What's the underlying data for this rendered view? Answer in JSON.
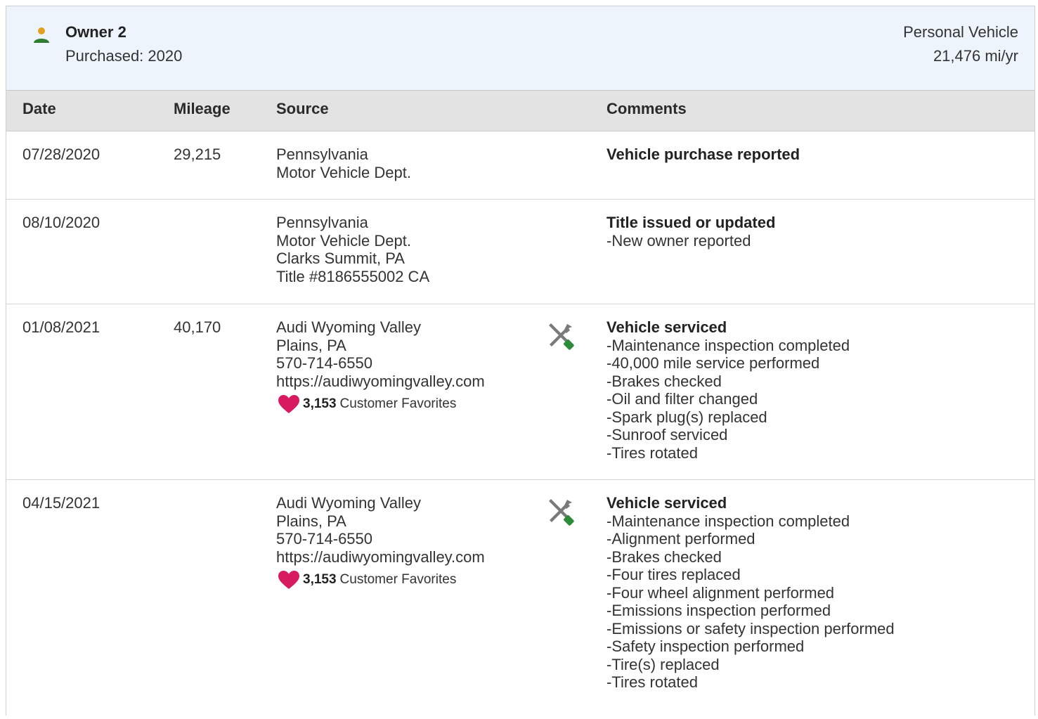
{
  "owner": {
    "title": "Owner 2",
    "purchased": "Purchased: 2020",
    "vehicle_type": "Personal Vehicle",
    "mileage_rate": "21,476 mi/yr"
  },
  "columns": {
    "date": "Date",
    "mileage": "Mileage",
    "source": "Source",
    "comments": "Comments"
  },
  "colors": {
    "header_bg": "#eef4fb",
    "column_bg": "#e3e3e3",
    "heart": "#d81b60",
    "wrench_gray": "#7a7a7a",
    "screwdriver_green": "#2e8b3a",
    "person_head": "#e0a020",
    "person_body": "#2e7d32"
  },
  "records": [
    {
      "date": "07/28/2020",
      "mileage": "29,215",
      "source": [
        "Pennsylvania",
        "Motor Vehicle Dept."
      ],
      "comment_title": "Vehicle purchase reported",
      "comment_items": []
    },
    {
      "date": "08/10/2020",
      "mileage": "",
      "source": [
        "Pennsylvania",
        "Motor Vehicle Dept.",
        "Clarks Summit, PA",
        "Title #8186555002 CA"
      ],
      "comment_title": "Title issued or updated",
      "comment_items": [
        "-New owner reported"
      ]
    },
    {
      "date": "01/08/2021",
      "mileage": "40,170",
      "source": [
        "Audi Wyoming Valley",
        "Plains, PA",
        "570-714-6550",
        "https://audiwyomingvalley.com"
      ],
      "favorites_count": "3,153",
      "favorites_label": "Customer Favorites",
      "service_icon": "wrench-screwdriver-icon",
      "comment_title": "Vehicle serviced",
      "comment_items": [
        "-Maintenance inspection completed",
        "-40,000 mile service performed",
        "-Brakes checked",
        "-Oil and filter changed",
        "-Spark plug(s) replaced",
        "-Sunroof serviced",
        "-Tires rotated"
      ]
    },
    {
      "date": "04/15/2021",
      "mileage": "",
      "source": [
        "Audi Wyoming Valley",
        "Plains, PA",
        "570-714-6550",
        "https://audiwyomingvalley.com"
      ],
      "favorites_count": "3,153",
      "favorites_label": "Customer Favorites",
      "service_icon": "wrench-screwdriver-icon",
      "comment_title": "Vehicle serviced",
      "comment_items": [
        "-Maintenance inspection completed",
        "-Alignment performed",
        "-Brakes checked",
        "-Four tires replaced",
        "-Four wheel alignment performed",
        "-Emissions inspection performed",
        "-Emissions or safety inspection performed",
        "-Safety inspection performed",
        "-Tire(s) replaced",
        "-Tires rotated"
      ]
    }
  ]
}
